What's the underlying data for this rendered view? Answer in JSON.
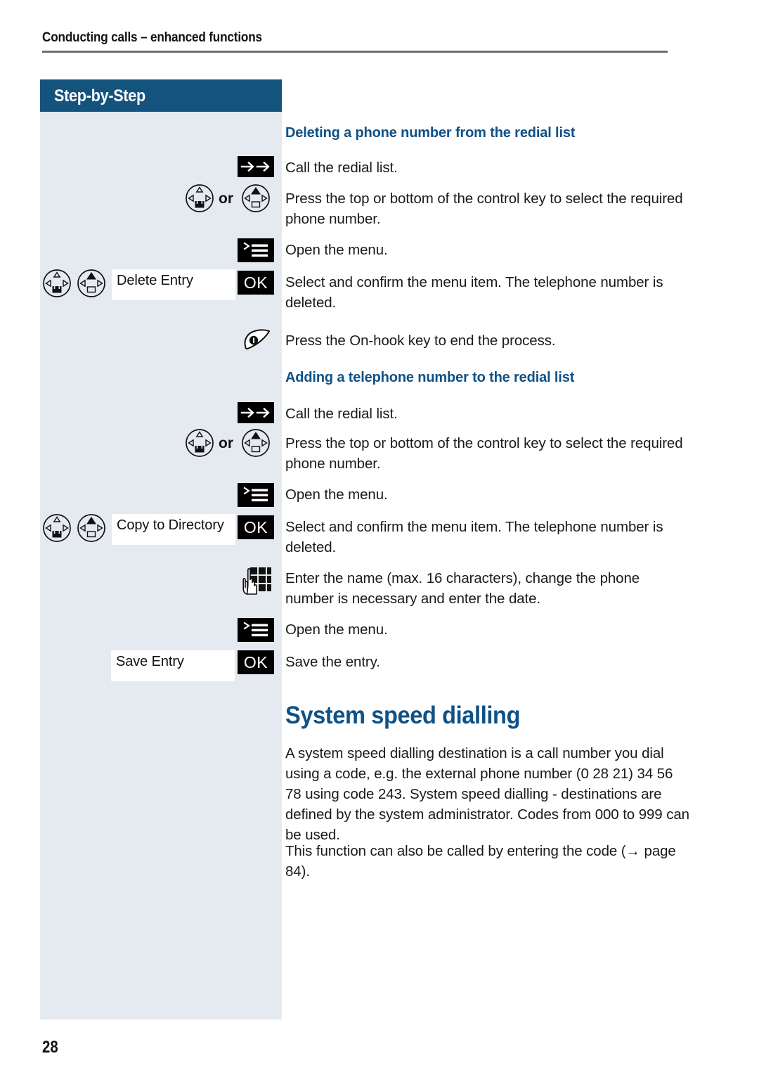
{
  "running_head": "Conducting calls – enhanced functions",
  "sidebar": {
    "header": "Step-by-Step",
    "background_color": "#e5eaf0",
    "header_color": "#15537f"
  },
  "page_number": "28",
  "accent_color": "#0f5186",
  "sections": [
    {
      "heading": "Deleting a phone number from the redial list",
      "steps": [
        {
          "icons": [
            "redial-key"
          ],
          "text": "Call the redial list."
        },
        {
          "icons": [
            "control-key-down",
            "or",
            "control-key-up"
          ],
          "text": "Press the top or bottom of the control key to select the required phone number."
        },
        {
          "icons": [
            "menu-key"
          ],
          "text": "Open the menu."
        },
        {
          "icons": [
            "control-key-down",
            "control-key-up",
            "display-field",
            "ok-key"
          ],
          "display_value": "Delete Entry",
          "ok_label": "OK",
          "text": "Select and confirm the menu item. The telephone number is deleted."
        },
        {
          "icons": [
            "on-hook-key"
          ],
          "text": "Press the On-hook key to end the process."
        }
      ]
    },
    {
      "heading": "Adding a telephone number to the redial list",
      "steps": [
        {
          "icons": [
            "redial-key"
          ],
          "text": "Call the redial list."
        },
        {
          "icons": [
            "control-key-down",
            "or",
            "control-key-up"
          ],
          "text": "Press the top or bottom of the control key to select the required phone number."
        },
        {
          "icons": [
            "menu-key"
          ],
          "text": "Open the menu."
        },
        {
          "icons": [
            "control-key-down",
            "control-key-up",
            "display-field",
            "ok-key"
          ],
          "display_value": "Copy to Directory",
          "ok_label": "OK",
          "text": "Select and confirm the menu item. The telephone number is deleted."
        },
        {
          "icons": [
            "keypad-key"
          ],
          "text": "Enter the name (max. 16 characters), change the phone number is necessary and enter the date."
        },
        {
          "icons": [
            "menu-key"
          ],
          "text": "Open the menu."
        },
        {
          "icons": [
            "display-field",
            "ok-key"
          ],
          "display_value": "Save Entry",
          "ok_label": "OK",
          "text": "Save the entry."
        }
      ]
    }
  ],
  "labels": {
    "or": "or",
    "ok": "OK",
    "delete_entry": "Delete Entry",
    "copy_to_directory": "Copy to Directory",
    "save_entry": "Save Entry"
  },
  "main_section": {
    "title": "System speed dialling",
    "paragraph_1": "A system speed dialling destination is a call number you dial using a code, e.g. the external phone number (0 28 21) 34 56 78 using code 243. System speed dialling - destinations are defined by the system administrator. Codes from 000 to 999 can be used.",
    "paragraph_2_prefix": "This function can also be called by entering the code (",
    "paragraph_2_arrow": "→",
    "paragraph_2_suffix": " page 84)."
  },
  "body_texts": {
    "call_redial_1": "Call the redial list.",
    "press_control_1": "Press the top or bottom of the control key to select the required phone number.",
    "open_menu_1": "Open the menu.",
    "select_confirm_1": "Select and confirm the menu item. The telephone number is deleted.",
    "on_hook_1": "Press the On-hook key to end the process.",
    "call_redial_2": "Call the redial list.",
    "press_control_2": "Press the top or bottom of the control key to select the required phone number.",
    "open_menu_2": "Open the menu.",
    "select_confirm_2": "Select and confirm the menu item. The telephone number is deleted.",
    "enter_name": "Enter the name (max. 16 characters), change the phone number is necessary and enter the date.",
    "open_menu_3": "Open the menu.",
    "save_entry_text": "Save the entry."
  }
}
